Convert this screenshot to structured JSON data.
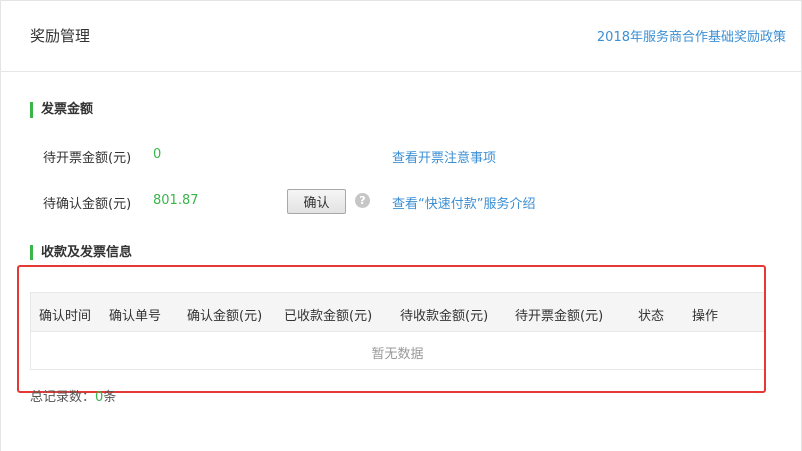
{
  "header": {
    "title": "奖励管理",
    "policy_link": "2018年服务商合作基础奖励政策"
  },
  "invoice_amount": {
    "section_title": "发票金额",
    "pending_invoice_label": "待开票金额(元)",
    "pending_invoice_value": "0",
    "invoice_notes_link": "查看开票注意事项",
    "pending_confirm_label": "待确认金额(元)",
    "pending_confirm_value": "801.87",
    "confirm_button": "确认",
    "help_icon": "?",
    "fast_pay_link": "查看“快速付款”服务介绍"
  },
  "receipts": {
    "section_title": "收款及发票信息",
    "columns": [
      "确认时间",
      "确认单号",
      "确认金额(元)",
      "已收款金额(元)",
      "待收款金额(元)",
      "待开票金额(元)",
      "状态",
      "操作"
    ],
    "empty_text": "暂无数据",
    "total_label": "总记录数：",
    "total_count": "0",
    "total_unit": "条"
  },
  "colors": {
    "accent_green": "#39b54a",
    "link_blue": "#3c8fd4",
    "highlight_red": "#e53935"
  },
  "icons": [
    "help-icon"
  ]
}
